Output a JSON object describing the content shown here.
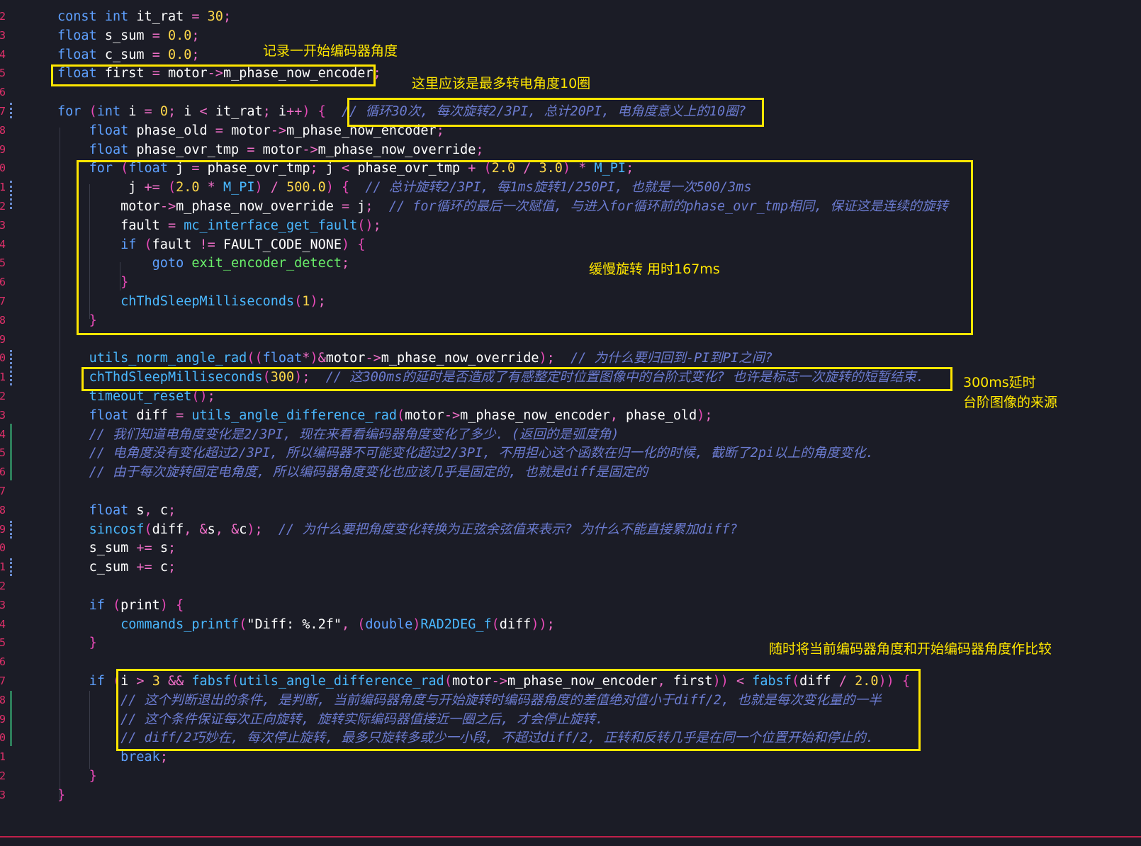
{
  "code": {
    "lines": [
      "const int it_rat = 30;",
      "float s_sum = 0.0;",
      "float c_sum = 0.0;",
      "float first = motor->m_phase_now_encoder;",
      "",
      "for (int i = 0; i < it_rat; i++) {  // 循环30次, 每次旋转2/3PI, 总计20PI, 电角度意义上的10圈?",
      "    float phase_old = motor->m_phase_now_encoder;",
      "    float phase_ovr_tmp = motor->m_phase_now_override;",
      "    for (float j = phase_ovr_tmp; j < phase_ovr_tmp + (2.0 / 3.0) * M_PI;",
      "         j += (2.0 * M_PI) / 500.0) {  // 总计旋转2/3PI, 每1ms旋转1/250PI, 也就是一次500/3ms",
      "        motor->m_phase_now_override = j;  // for循环的最后一次赋值, 与进入for循环前的phase_ovr_tmp相同, 保证这是连续的旋转",
      "        fault = mc_interface_get_fault();",
      "        if (fault != FAULT_CODE_NONE) {",
      "            goto exit_encoder_detect;",
      "        }",
      "        chThdSleepMilliseconds(1);",
      "    }",
      "",
      "    utils_norm_angle_rad((float*)&motor->m_phase_now_override);  // 为什么要归回到-PI到PI之间?",
      "    chThdSleepMilliseconds(300);  // 这300ms的延时是否造成了有感整定时位置图像中的台阶式变化? 也许是标志一次旋转的短暂结束.",
      "    timeout_reset();",
      "    float diff = utils_angle_difference_rad(motor->m_phase_now_encoder, phase_old);",
      "    // 我们知道电角度变化是2/3PI, 现在来看看编码器角度变化了多少. (返回的是弧度角)",
      "    // 电角度没有变化超过2/3PI, 所以编码器不可能变化超过2/3PI, 不用担心这个函数在归一化的时候, 截断了2pi以上的角度变化.",
      "    // 由于每次旋转固定电角度, 所以编码器角度变化也应该几乎是固定的, 也就是diff是固定的",
      "",
      "    float s, c;",
      "    sincosf(diff, &s, &c);  // 为什么要把角度变化转换为正弦余弦值来表示? 为什么不能直接累加diff?",
      "    s_sum += s;",
      "    c_sum += c;",
      "",
      "    if (print) {",
      "        commands_printf(\"Diff: %.2f\", (double)RAD2DEG_f(diff));",
      "    }",
      "",
      "    if (i > 3 && fabsf(utils_angle_difference_rad(motor->m_phase_now_encoder, first)) < fabsf(diff / 2.0)) {",
      "        // 这个判断退出的条件, 是判断, 当前编码器角度与开始旋转时编码器角度的差值绝对值小于diff/2, 也就是每次变化量的一半",
      "        // 这个条件保证每次正向旋转, 旋转实际编码器值接近一圈之后, 才会停止旋转.",
      "        // diff/2巧妙在, 每次停止旋转, 最多只旋转多或少一小段, 不超过diff/2, 正转和反转几乎是在同一个位置开始和停止的.",
      "        break;",
      "    }",
      "}"
    ],
    "line_numbers": [
      "2",
      "3",
      "4",
      "5",
      "6",
      "7",
      "8",
      "9",
      "0",
      "1",
      "2",
      "3",
      "4",
      "5",
      "6",
      "7",
      "8",
      "9",
      "0",
      "1",
      "2",
      "3",
      "4",
      "5",
      "6",
      "7",
      "8",
      "9",
      "0",
      "1",
      "2",
      "3",
      "4",
      "5",
      "6",
      "7",
      "8",
      "9",
      "0",
      "1",
      "2",
      "3"
    ]
  },
  "annotations": {
    "note_first": "记录一开始编码器角度",
    "note_10_turns": "这里应该是最多转电角度10圈",
    "note_slow": "缓慢旋转 用时167ms",
    "note_300ms_1": "300ms延时",
    "note_300ms_2": "台阶图像的来源",
    "note_compare": "随时将当前编码器角度和开始编码器角度作比较"
  },
  "colors": {
    "background": "#1b1c26",
    "keyword": "#5ea0ff",
    "comment": "#6b7bd0",
    "number": "#ffd84a",
    "highlight_box": "#ffe600",
    "line_number": "#e0306a"
  }
}
